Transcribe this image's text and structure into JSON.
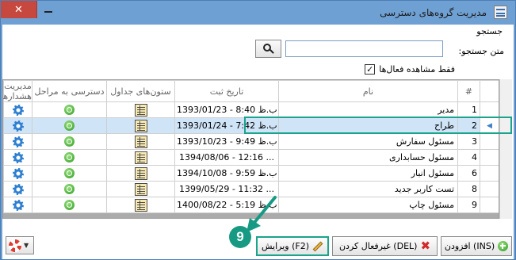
{
  "window": {
    "title": "مدیریت گروه‌های دسترسی"
  },
  "search": {
    "group_label": "جستجو",
    "text_label": "متن جستجو:",
    "value": "",
    "active_only_label": "فقط مشاهده فعال‌ها",
    "active_only_checked": true,
    "active_only_mark": "✓"
  },
  "grid": {
    "columns": {
      "row_number": "#",
      "name": "نام",
      "registration_date": "تاریخ ثبت",
      "table_columns": "ستون‌های جداول",
      "step_access": "دسترسی به مراحل",
      "alert_management": "مدیریت هشدارها"
    },
    "selected_row_indicator": "◀",
    "rows": [
      {
        "number": "1",
        "name": "مدیر",
        "date": "1393/01/23 - 8:40 ب.ظ",
        "selected": false
      },
      {
        "number": "2",
        "name": "طراح",
        "date": "1393/01/24 - 7:42 ب.ظ",
        "selected": true
      },
      {
        "number": "3",
        "name": "مسئول سفارش",
        "date": "1393/10/23 - 9:49 ب.ظ",
        "selected": false
      },
      {
        "number": "4",
        "name": "مسئول حسابداری",
        "date": "1394/08/06 - 12:16 ...",
        "selected": false
      },
      {
        "number": "6",
        "name": "مسئول انبار",
        "date": "1394/10/08 - 9:59 ب.ظ",
        "selected": false
      },
      {
        "number": "8",
        "name": "تست کاربر جدید",
        "date": "1399/05/29 - 11:32 ...",
        "selected": false
      },
      {
        "number": "9",
        "name": "مسئول چاپ",
        "date": "1400/08/22 - 5:19 ب.ظ",
        "selected": false
      }
    ]
  },
  "buttons": {
    "add_label": "(INS) افزودن",
    "deactivate_label": "(DEL) غیرفعال کردن",
    "edit_label": "(F2) ویرایش"
  },
  "annotation": {
    "step_number": "9",
    "color": "#179a84"
  }
}
